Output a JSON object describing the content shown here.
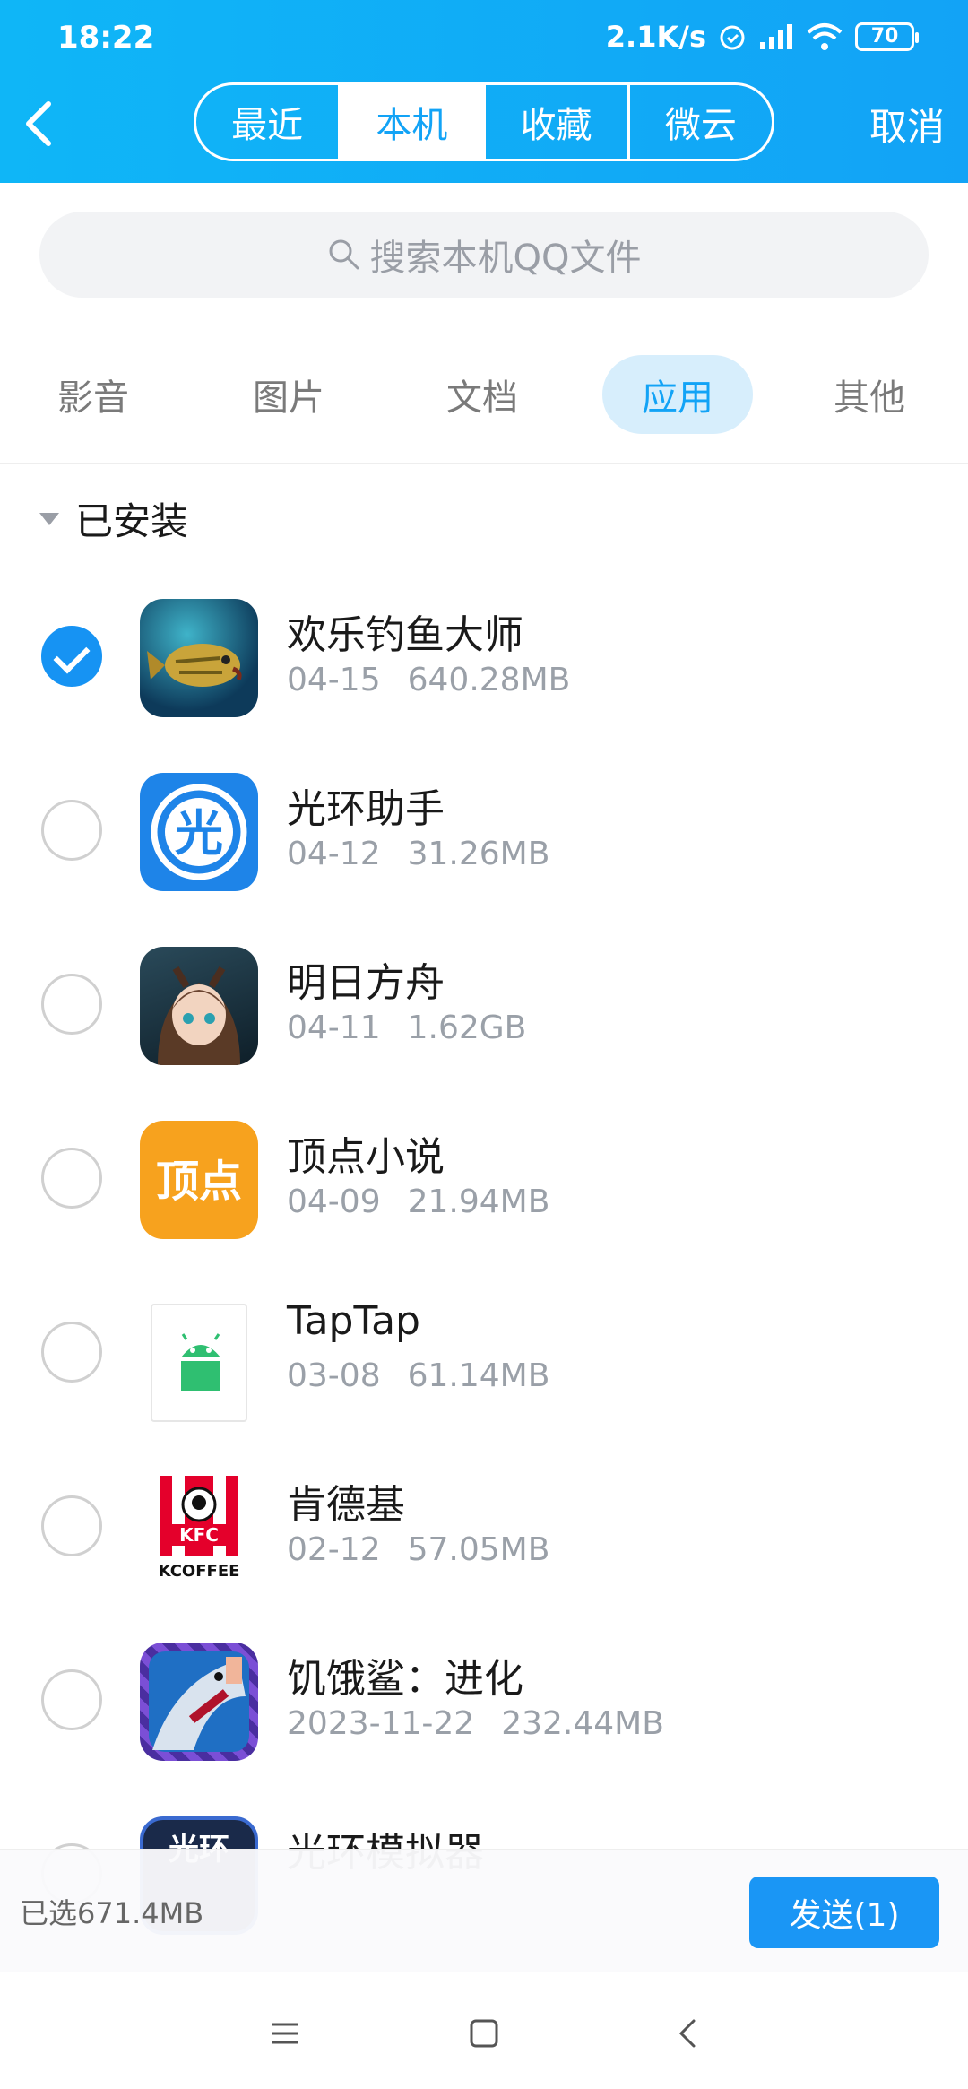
{
  "status": {
    "time": "18:22",
    "speed": "2.1K/s",
    "battery": "70"
  },
  "header": {
    "tabs": [
      "最近",
      "本机",
      "收藏",
      "微云"
    ],
    "active_tab": 1,
    "cancel": "取消"
  },
  "search": {
    "placeholder": "搜索本机QQ文件"
  },
  "categories": [
    "影音",
    "图片",
    "文档",
    "应用",
    "其他"
  ],
  "active_category": 3,
  "section": {
    "title": "已安装"
  },
  "apps": [
    {
      "name": "欢乐钓鱼大师",
      "date": "04-15",
      "size": "640.28MB",
      "checked": true
    },
    {
      "name": "光环助手",
      "date": "04-12",
      "size": "31.26MB",
      "checked": false
    },
    {
      "name": "明日方舟",
      "date": "04-11",
      "size": "1.62GB",
      "checked": false
    },
    {
      "name": "顶点小说",
      "date": "04-09",
      "size": "21.94MB",
      "checked": false
    },
    {
      "name": "TapTap",
      "date": "03-08",
      "size": "61.14MB",
      "checked": false
    },
    {
      "name": "肯德基",
      "date": "02-12",
      "size": "57.05MB",
      "checked": false
    },
    {
      "name": "饥饿鲨：进化",
      "date": "2023-11-22",
      "size": "232.44MB",
      "checked": false
    },
    {
      "name": "光环模拟器",
      "date": "",
      "size": "",
      "checked": false
    }
  ],
  "icon_text": {
    "guanghuan": "光",
    "dingdian": "顶点",
    "kfc_brand": "KFC",
    "kfc_sub": "KCOFFEE",
    "emulator": "光环"
  },
  "footer": {
    "selected": "已选671.4MB",
    "send": "发送(1)"
  },
  "colors": {
    "accent": "#12a3f6",
    "send": "#1a96f5"
  }
}
